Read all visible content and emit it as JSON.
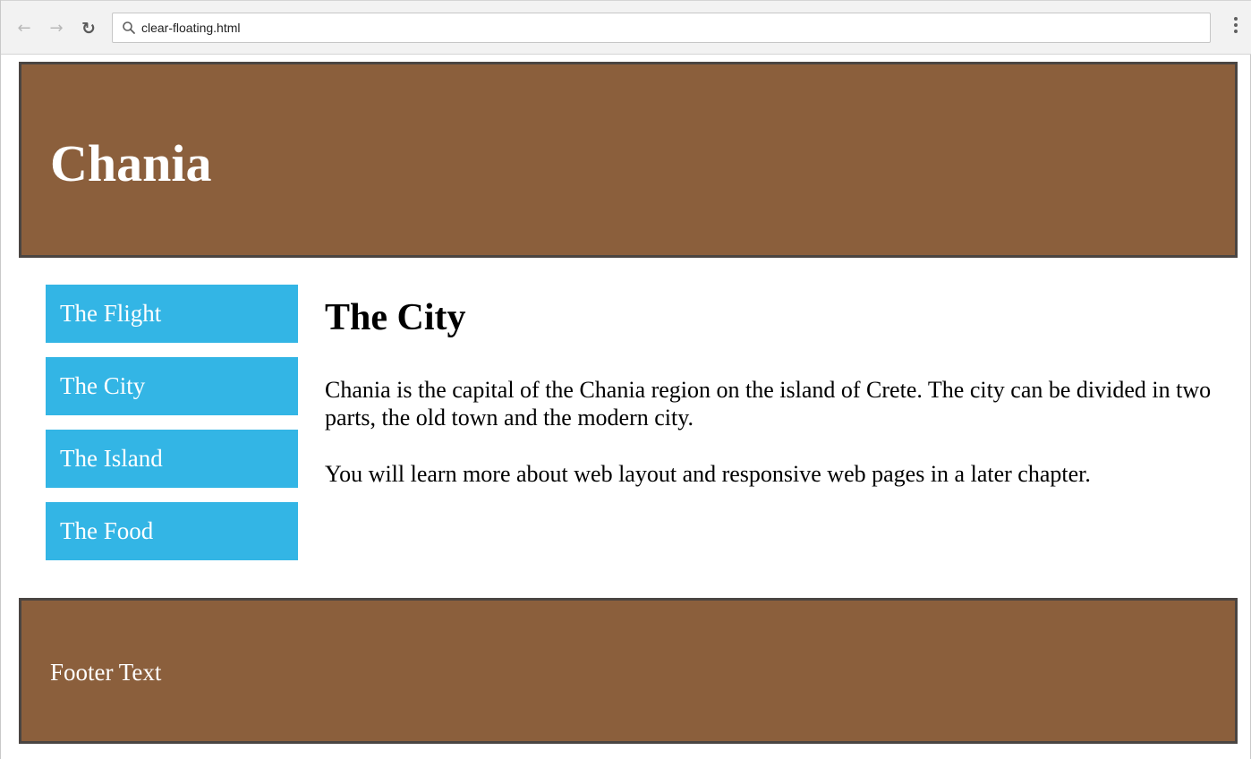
{
  "browser": {
    "address": "clear-floating.html",
    "icons": {
      "back": "arrow-left-icon",
      "forward": "arrow-right-icon",
      "reload": "reload-icon",
      "search": "search-icon",
      "menu": "kebab-menu-icon"
    }
  },
  "header": {
    "title": "Chania"
  },
  "nav": {
    "items": [
      {
        "label": "The Flight"
      },
      {
        "label": "The City"
      },
      {
        "label": "The Island"
      },
      {
        "label": "The Food"
      }
    ]
  },
  "article": {
    "heading": "The City",
    "paragraphs": [
      "Chania is the capital of the Chania region on the island of Crete. The city can be divided in two parts, the old town and the modern city.",
      "You will learn more about web layout and responsive web pages in a later chapter."
    ]
  },
  "footer": {
    "text": "Footer Text"
  },
  "colors": {
    "header_bg": "#8b5f3c",
    "border": "#4a4542",
    "nav_bg": "#33b5e5",
    "text_light": "#ffffff"
  }
}
